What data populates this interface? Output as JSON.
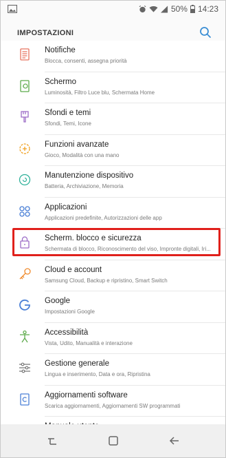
{
  "status": {
    "battery": "50%",
    "time": "14:23"
  },
  "header": {
    "title": "IMPOSTAZIONI"
  },
  "items": [
    {
      "label": "Notifiche",
      "sub": "Blocca, consenti, assegna priorità",
      "icon": "notifications-icon",
      "color": "#e8735f"
    },
    {
      "label": "Schermo",
      "sub": "Luminosità, Filtro Luce blu, Schermata Home",
      "icon": "display-icon",
      "color": "#5caa4a"
    },
    {
      "label": "Sfondi e temi",
      "sub": "Sfondi, Temi, Icone",
      "icon": "brush-icon",
      "color": "#9c6cc7"
    },
    {
      "label": "Funzioni avanzate",
      "sub": "Gioco, Modalità con una mano",
      "icon": "gear-plus-icon",
      "color": "#f0a020"
    },
    {
      "label": "Manutenzione dispositivo",
      "sub": "Batteria, Archiviazione, Memoria",
      "icon": "maintenance-icon",
      "color": "#2fb19a"
    },
    {
      "label": "Applicazioni",
      "sub": "Applicazioni predefinite, Autorizzazioni delle app",
      "icon": "apps-icon",
      "color": "#4a7fd6"
    },
    {
      "label": "Scherm. blocco e sicurezza",
      "sub": "Schermata di blocco, Riconoscimento del viso, Impronte digitali, Iri...",
      "icon": "lock-icon",
      "color": "#9c6cc7"
    },
    {
      "label": "Cloud e account",
      "sub": "Samsung Cloud, Backup e ripristino, Smart Switch",
      "icon": "key-icon",
      "color": "#f08a2c"
    },
    {
      "label": "Google",
      "sub": "Impostazioni Google",
      "icon": "google-icon",
      "color": "#4a7fd6"
    },
    {
      "label": "Accessibilità",
      "sub": "Vista, Udito, Manualità e interazione",
      "icon": "accessibility-icon",
      "color": "#5caa4a"
    },
    {
      "label": "Gestione generale",
      "sub": "Lingua e inserimento, Data e ora, Ripristina",
      "icon": "sliders-icon",
      "color": "#777777"
    },
    {
      "label": "Aggiornamenti software",
      "sub": "Scarica aggiornamenti, Aggiornamenti SW programmati",
      "icon": "update-icon",
      "color": "#4a7fd6"
    },
    {
      "label": "Manuale utente",
      "sub": "",
      "icon": "manual-icon",
      "color": "#f0a020"
    }
  ]
}
